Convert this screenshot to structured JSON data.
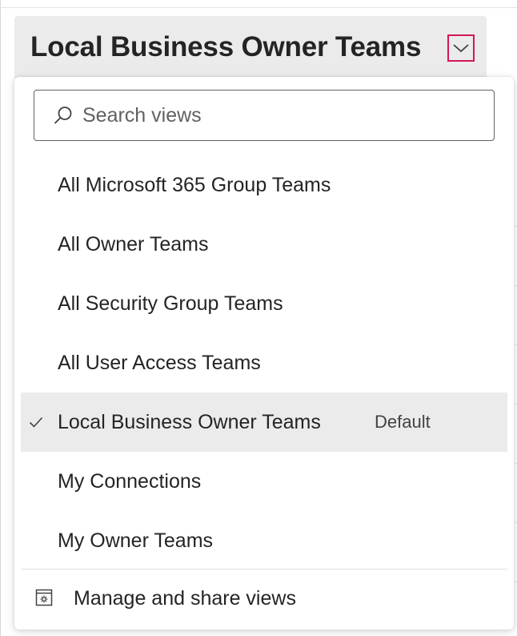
{
  "header": {
    "title": "Local Business Owner Teams",
    "chevron_icon": "chevron-down-icon",
    "accent_color": "#d4145a"
  },
  "search": {
    "placeholder": "Search views",
    "value": "",
    "icon": "search-icon"
  },
  "views": [
    {
      "label": "All Microsoft 365 Group Teams",
      "selected": false
    },
    {
      "label": "All Owner Teams",
      "selected": false
    },
    {
      "label": "All Security Group Teams",
      "selected": false
    },
    {
      "label": "All User Access Teams",
      "selected": false
    },
    {
      "label": "Local Business Owner Teams",
      "selected": true,
      "badge": "Default",
      "icon": "checkmark-icon"
    },
    {
      "label": "My Connections",
      "selected": false
    },
    {
      "label": "My Owner Teams",
      "selected": false
    }
  ],
  "footer": {
    "manage_label": "Manage and share views",
    "icon": "settings-window-icon"
  },
  "colors": {
    "header_bg": "#ebebeb",
    "selected_bg": "#ebebeb",
    "text": "#242424"
  }
}
